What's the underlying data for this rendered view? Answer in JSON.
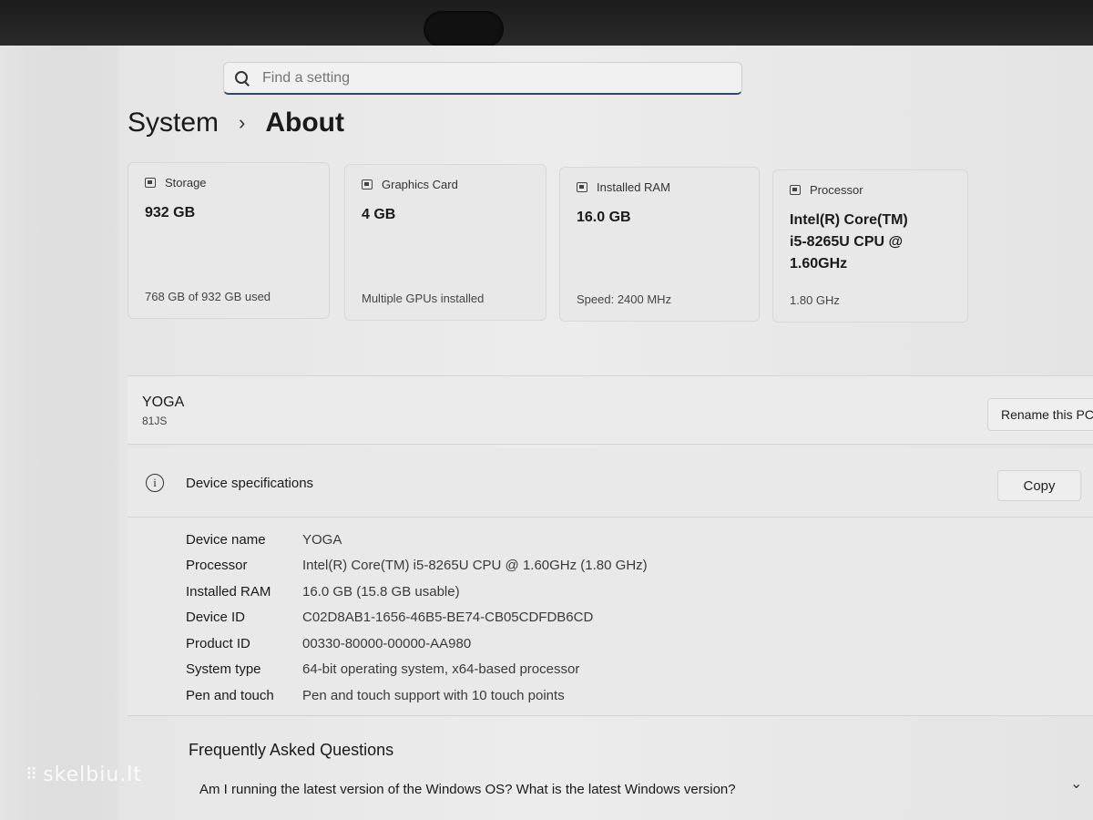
{
  "search": {
    "placeholder": "Find a setting"
  },
  "breadcrumb": {
    "parent": "System",
    "separator": "›",
    "current": "About"
  },
  "cards": [
    {
      "icon": "storage-icon",
      "title": "Storage",
      "value": "932 GB",
      "footer": "768 GB of 932 GB used"
    },
    {
      "icon": "graphics-card-icon",
      "title": "Graphics Card",
      "value": "4 GB",
      "footer": "Multiple GPUs installed"
    },
    {
      "icon": "ram-icon",
      "title": "Installed RAM",
      "value": "16.0 GB",
      "footer": "Speed: 2400 MHz"
    },
    {
      "icon": "processor-icon",
      "title": "Processor",
      "value": "Intel(R) Core(TM) i5-8265U CPU @ 1.60GHz",
      "footer": "1.80 GHz"
    }
  ],
  "device": {
    "name": "YOGA",
    "model": "81JS",
    "rename_label": "Rename this PC"
  },
  "specs": {
    "info_icon": "i",
    "title": "Device specifications",
    "copy_label": "Copy",
    "rows": [
      {
        "label": "Device name",
        "value": "YOGA"
      },
      {
        "label": "Processor",
        "value": "Intel(R) Core(TM) i5-8265U CPU @ 1.60GHz (1.80 GHz)"
      },
      {
        "label": "Installed RAM",
        "value": "16.0 GB (15.8 GB usable)"
      },
      {
        "label": "Device ID",
        "value": "C02D8AB1-1656-46B5-BE74-CB05CDFDB6CD"
      },
      {
        "label": "Product ID",
        "value": "00330-80000-00000-AA980"
      },
      {
        "label": "System type",
        "value": "64-bit operating system, x64-based processor"
      },
      {
        "label": "Pen and touch",
        "value": "Pen and touch support with 10 touch points"
      }
    ]
  },
  "faq": {
    "title": "Frequently Asked Questions",
    "question": "Am I running the latest version of the Windows OS? What is the latest Windows version?",
    "chevron": "⌄"
  },
  "watermark": {
    "dots": "⠿",
    "text": "skelbiu.lt"
  }
}
